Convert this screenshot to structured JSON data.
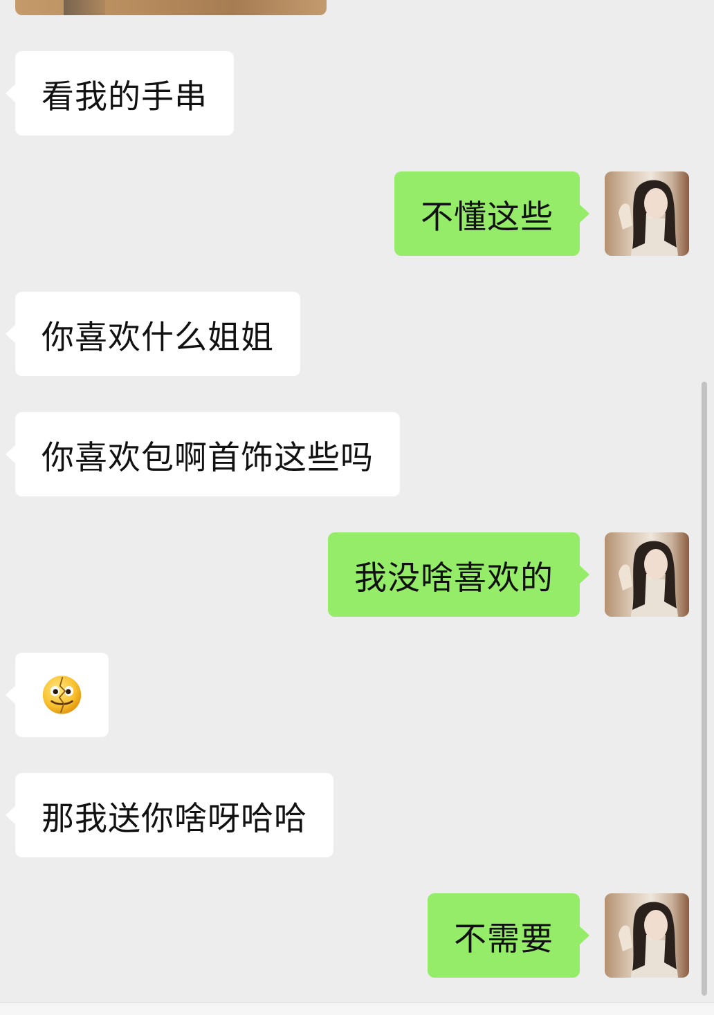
{
  "messages": [
    {
      "side": "in",
      "text": "看我的手串"
    },
    {
      "side": "out",
      "text": "不懂这些"
    },
    {
      "side": "in",
      "text": "你喜欢什么姐姐"
    },
    {
      "side": "in",
      "text": "你喜欢包啊首饰这些吗"
    },
    {
      "side": "out",
      "text": "我没啥喜欢的"
    },
    {
      "side": "in",
      "emoji": "shattered-face-emoji"
    },
    {
      "side": "in",
      "text": "那我送你啥呀哈哈"
    },
    {
      "side": "out",
      "text": "不需要"
    }
  ],
  "colors": {
    "background": "#ededed",
    "incoming_bubble": "#ffffff",
    "outgoing_bubble": "#95ec69",
    "text": "#111111"
  }
}
